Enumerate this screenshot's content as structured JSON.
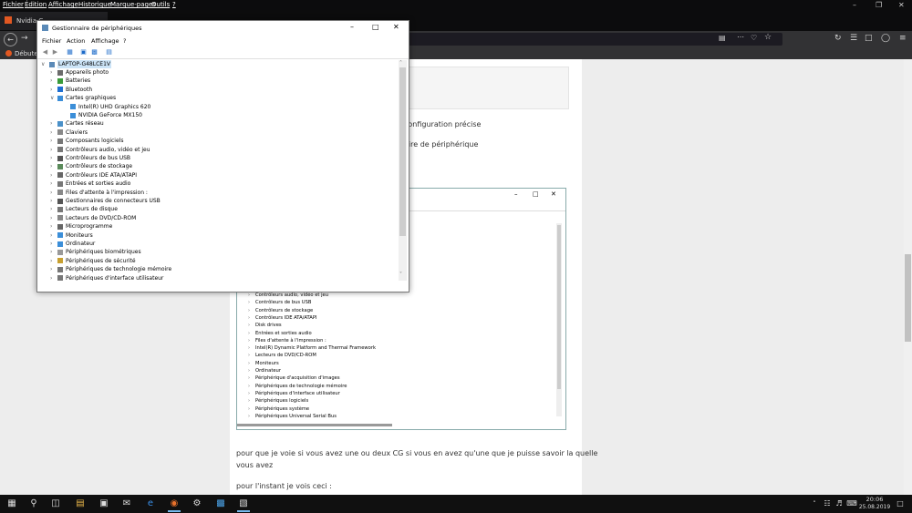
{
  "firefox": {
    "menu": [
      "Fichier",
      "Édition",
      "Affichage",
      "Historique",
      "Marque-pages",
      "Outils",
      "?"
    ],
    "tab_title": "Nvidia G",
    "bookmark": "Débuter"
  },
  "page": {
    "text1": "configuration précise",
    "text2": "aire de périphérique",
    "para1_l1": "pour que je voie si vous avez une ou deux CG si vous en avez qu'une que je puisse savoir la quelle",
    "para1_l2": "vous avez",
    "para2": "pour l'instant je vois ceci :",
    "embedded_items": [
      "Contrôleurs audio, vidéo et jeu",
      "Contrôleurs de bus USB",
      "Contrôleurs de stockage",
      "Contrôleurs IDE ATA/ATAPI",
      "Disk drives",
      "Entrées et sorties audio",
      "Files d'attente à l'impression :",
      "Intel(R) Dynamic Platform and Thermal Framework",
      "Lecteurs de DVD/CD-ROM",
      "Moniteurs",
      "Ordinateur",
      "Périphérique d'acquisition d'images",
      "Périphériques de technologie mémoire",
      "Périphériques d'interface utilisateur",
      "Périphériques logiciels",
      "Périphériques système",
      "Périphériques Universal Serial Bus"
    ]
  },
  "device_manager": {
    "title": "Gestionnaire de périphériques",
    "menu": [
      "Fichier",
      "Action",
      "Affichage",
      "?"
    ],
    "root": "LAPTOP-G48LCE1V",
    "items": [
      {
        "label": "Appareils photo",
        "level": 1,
        "expanded": false,
        "color": "#6b6b6b"
      },
      {
        "label": "Batteries",
        "level": 1,
        "expanded": false,
        "color": "#3a9b3a"
      },
      {
        "label": "Bluetooth",
        "level": 1,
        "expanded": false,
        "color": "#1f6fd1"
      },
      {
        "label": "Cartes graphiques",
        "level": 1,
        "expanded": true,
        "color": "#3b8ed8"
      },
      {
        "label": "Intel(R) UHD Graphics 620",
        "level": 2,
        "color": "#3b8ed8"
      },
      {
        "label": "NVIDIA GeForce MX150",
        "level": 2,
        "color": "#3b8ed8"
      },
      {
        "label": "Cartes réseau",
        "level": 1,
        "expanded": false,
        "color": "#4a90c8"
      },
      {
        "label": "Claviers",
        "level": 1,
        "expanded": false,
        "color": "#888888"
      },
      {
        "label": "Composants logiciels",
        "level": 1,
        "expanded": false,
        "color": "#777777"
      },
      {
        "label": "Contrôleurs audio, vidéo et jeu",
        "level": 1,
        "expanded": false,
        "color": "#777777"
      },
      {
        "label": "Contrôleurs de bus USB",
        "level": 1,
        "expanded": false,
        "color": "#555555"
      },
      {
        "label": "Contrôleurs de stockage",
        "level": 1,
        "expanded": false,
        "color": "#5a8a5a"
      },
      {
        "label": "Contrôleurs IDE ATA/ATAPI",
        "level": 1,
        "expanded": false,
        "color": "#666666"
      },
      {
        "label": "Entrées et sorties audio",
        "level": 1,
        "expanded": false,
        "color": "#777777"
      },
      {
        "label": "Files d'attente à l'impression :",
        "level": 1,
        "expanded": false,
        "color": "#888888"
      },
      {
        "label": "Gestionnaires de connecteurs USB",
        "level": 1,
        "expanded": false,
        "color": "#555555"
      },
      {
        "label": "Lecteurs de disque",
        "level": 1,
        "expanded": false,
        "color": "#777777"
      },
      {
        "label": "Lecteurs de DVD/CD-ROM",
        "level": 1,
        "expanded": false,
        "color": "#888888"
      },
      {
        "label": "Microprogramme",
        "level": 1,
        "expanded": false,
        "color": "#666666"
      },
      {
        "label": "Moniteurs",
        "level": 1,
        "expanded": false,
        "color": "#3b8ed8"
      },
      {
        "label": "Ordinateur",
        "level": 1,
        "expanded": false,
        "color": "#3b8ed8"
      },
      {
        "label": "Périphériques biométriques",
        "level": 1,
        "expanded": false,
        "color": "#999999"
      },
      {
        "label": "Périphériques de sécurité",
        "level": 1,
        "expanded": false,
        "color": "#c8a030"
      },
      {
        "label": "Périphériques de technologie mémoire",
        "level": 1,
        "expanded": false,
        "color": "#777777"
      },
      {
        "label": "Périphériques d'interface utilisateur",
        "level": 1,
        "expanded": false,
        "color": "#777777"
      }
    ]
  },
  "taskbar": {
    "time": "20:06",
    "date": "25.08.2019"
  }
}
